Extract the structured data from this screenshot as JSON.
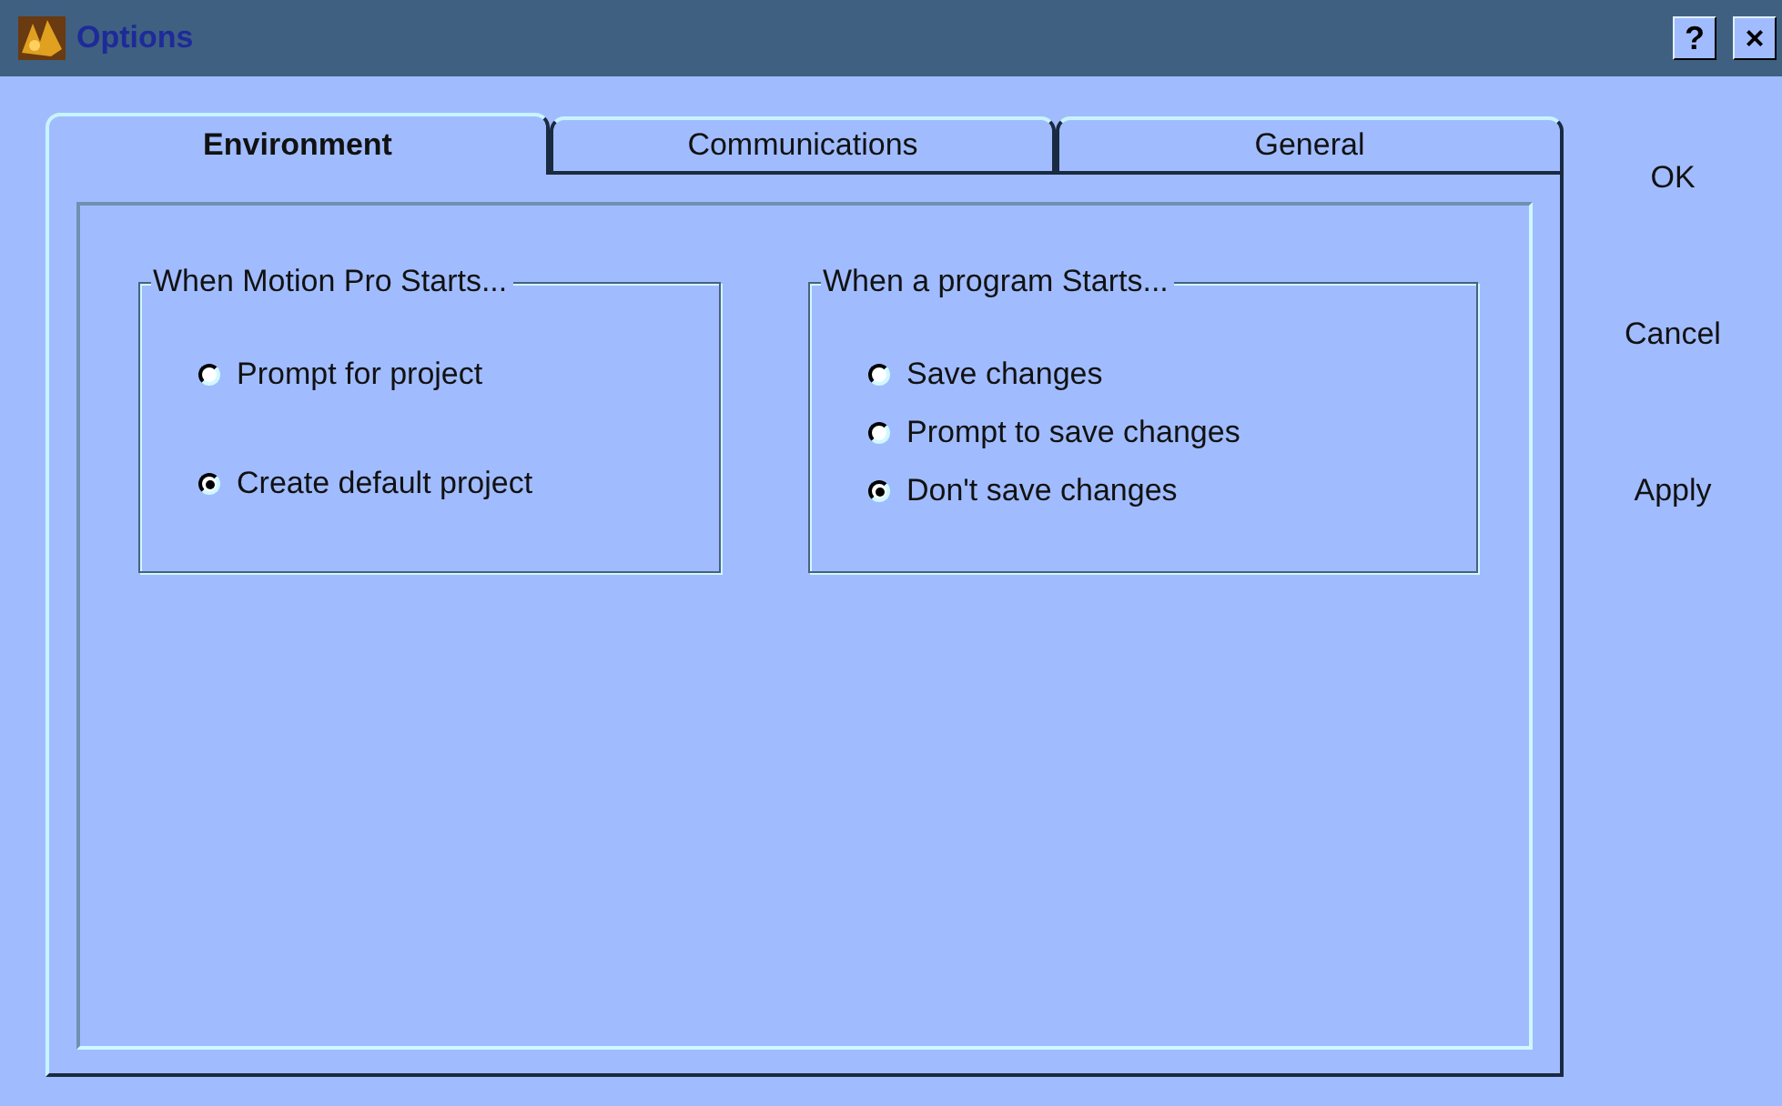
{
  "window": {
    "title": "Options",
    "controls": [
      "?",
      "×"
    ]
  },
  "tabs": [
    {
      "label": "Environment",
      "selected": true
    },
    {
      "label": "Communications",
      "selected": false
    },
    {
      "label": "General",
      "selected": false
    }
  ],
  "groups": [
    {
      "title": "When Motion Pro Starts...",
      "options": [
        {
          "label": "Prompt for project",
          "selected": false
        },
        {
          "label": "Create default project",
          "selected": true
        }
      ]
    },
    {
      "title": "When a program Starts...",
      "options": [
        {
          "label": "Save changes",
          "selected": false
        },
        {
          "label": "Prompt to save changes",
          "selected": false
        },
        {
          "label": "Don't save changes",
          "selected": true
        }
      ]
    }
  ],
  "buttons": [
    "OK",
    "Cancel",
    "Apply"
  ]
}
